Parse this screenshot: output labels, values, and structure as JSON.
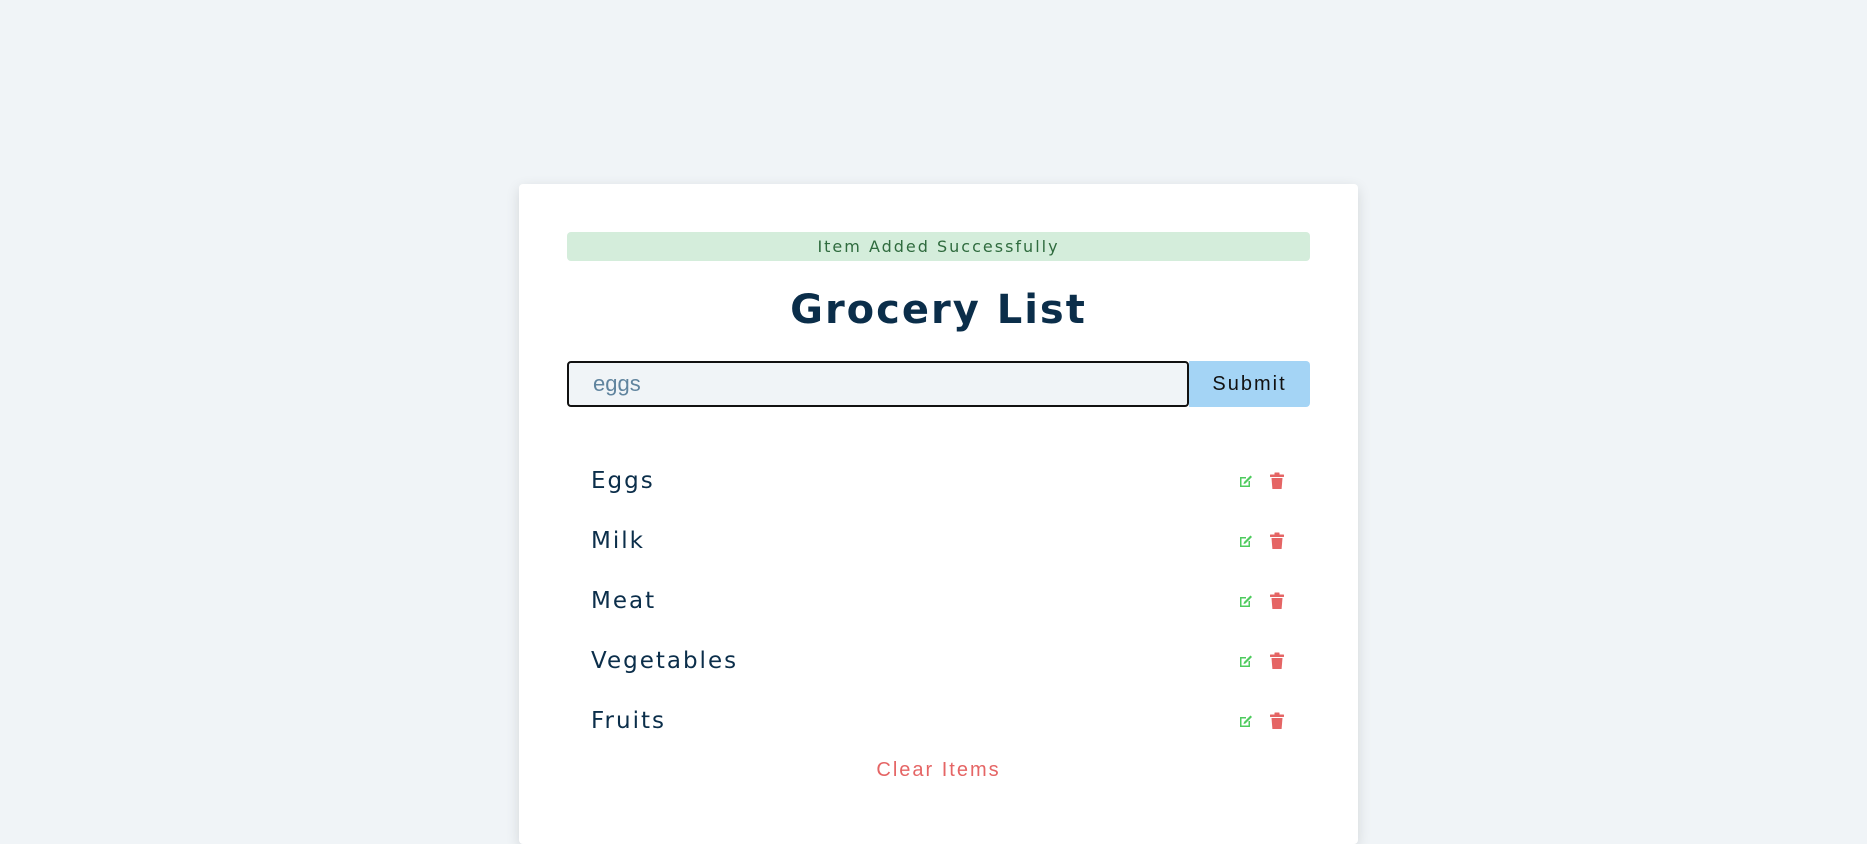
{
  "alert": {
    "text": "Item Added Successfully"
  },
  "title": "Grocery List",
  "form": {
    "input_placeholder": "eggs",
    "input_value": "",
    "submit_label": "Submit"
  },
  "items": [
    {
      "name": "Eggs"
    },
    {
      "name": "Milk"
    },
    {
      "name": "Meat"
    },
    {
      "name": "Vegetables"
    },
    {
      "name": "Fruits"
    }
  ],
  "item_icons": {
    "edit": "edit-icon",
    "delete": "trash-icon"
  },
  "clear_label": "Clear Items",
  "colors": {
    "background": "#f0f4f7",
    "card": "#ffffff",
    "alert_bg": "#d4eddb",
    "alert_text": "#2f6b3e",
    "title": "#0b2e4a",
    "submit_bg": "#a4d4f5",
    "edit_icon": "#4ecb5e",
    "delete_icon": "#e56565",
    "clear_text": "#e56565"
  }
}
